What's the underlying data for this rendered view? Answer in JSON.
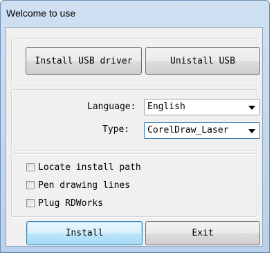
{
  "window": {
    "title": "Welcome to use"
  },
  "driver": {
    "install_usb_label": "Install USB driver",
    "uninstall_usb_label": "Unistall USB"
  },
  "settings": {
    "language_label": "Language:",
    "language_value": "English",
    "type_label": "Type:",
    "type_value": "CorelDraw_Laser"
  },
  "options": [
    {
      "label": "Locate install path",
      "checked": false
    },
    {
      "label": "Pen drawing lines",
      "checked": false
    },
    {
      "label": "Plug RDWorks",
      "checked": false
    }
  ],
  "actions": {
    "install_label": "Install",
    "exit_label": "Exit"
  },
  "colors": {
    "titlebar": "#c6dbef",
    "default_button_border": "#3c7fb1"
  }
}
